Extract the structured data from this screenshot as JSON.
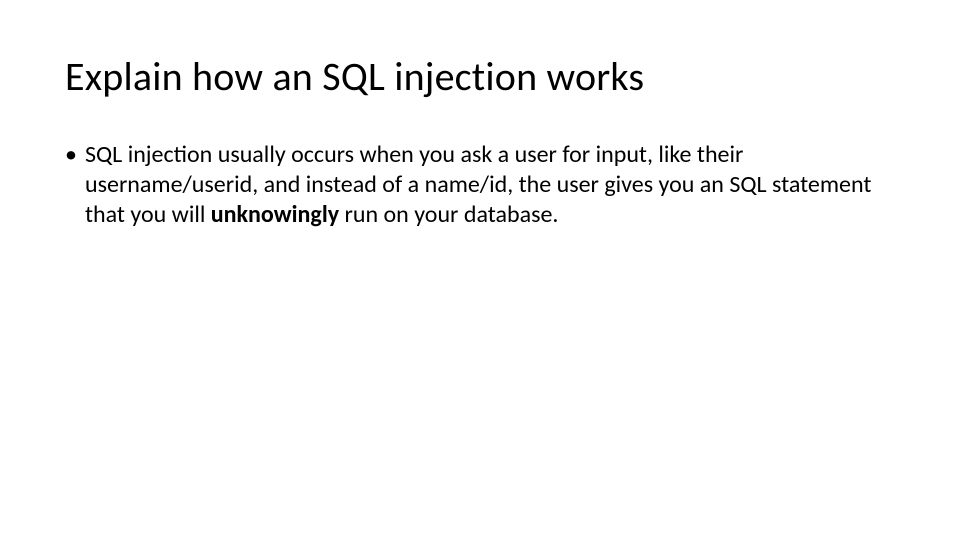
{
  "slide": {
    "title": "Explain how an SQL injection works",
    "bullets": [
      {
        "marker": "•",
        "text_pre": "SQL injection usually occurs when you ask a user for input, like their username/userid, and instead of a name/id, the user gives you an SQL statement that you will ",
        "text_bold": "unknowingly",
        "text_post": " run on your database."
      }
    ]
  }
}
